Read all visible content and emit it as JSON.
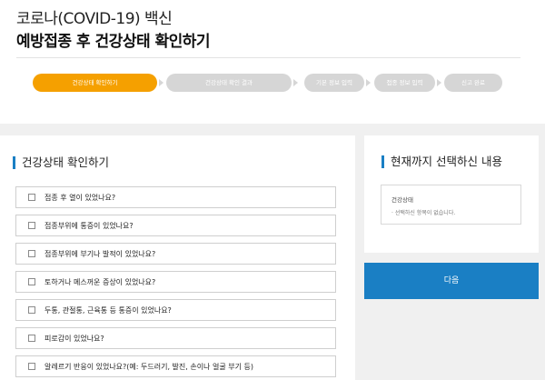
{
  "header": {
    "title_line1": "코로나(COVID-19) 백신",
    "title_line2": "예방접종 후 건강상태 확인하기"
  },
  "steps": [
    {
      "label": "건강상태 확인하기",
      "active": true
    },
    {
      "label": "건강상태 확인 결과",
      "active": false
    },
    {
      "label": "기본 정보 입력",
      "active": false
    },
    {
      "label": "접종 정보 입력",
      "active": false
    },
    {
      "label": "신고 완료",
      "active": false
    }
  ],
  "left_panel": {
    "title": "건강상태 확인하기",
    "questions": [
      "접종 후 열이 있었나요?",
      "접종부위에 통증이 있었나요?",
      "접종부위에 부기나 발적이 있었나요?",
      "토하거나 메스꺼운 증상이 있었나요?",
      "두통, 관절통, 근육통 등 통증이 있었나요?",
      "피로감이 있었나요?",
      "알레르기 반응이 있었나요?(예: 두드러기, 발진, 손이나 얼굴 부기 등)"
    ]
  },
  "right_panel": {
    "title": "현재까지 선택하신 내용",
    "box_title": "건강상태",
    "empty_text": "· 선택하신 항목이 없습니다."
  },
  "next_button": "다음",
  "colors": {
    "accent_orange": "#f5a000",
    "accent_blue": "#1a7fc4",
    "step_inactive": "#d6d6d6"
  }
}
